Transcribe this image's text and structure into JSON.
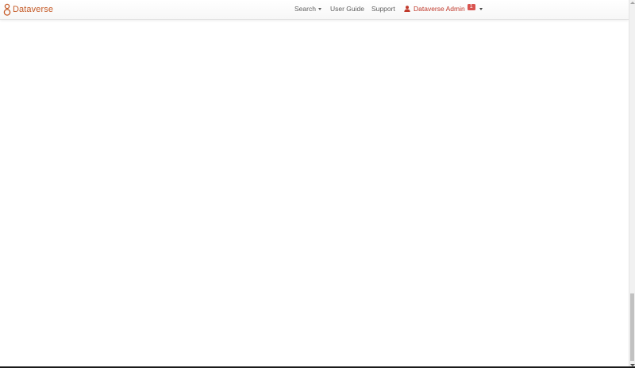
{
  "navbar": {
    "brand": {
      "label": "Dataverse",
      "icon": "dataverse-logo-icon",
      "color": "#c55b28"
    },
    "search": {
      "label": "Search"
    },
    "user_guide": {
      "label": "User Guide"
    },
    "support": {
      "label": "Support"
    },
    "user_menu": {
      "label": "Dataverse Admin",
      "icon": "user-icon",
      "badge": "1",
      "color": "#c0392b",
      "badge_color": "#d9534f"
    }
  }
}
